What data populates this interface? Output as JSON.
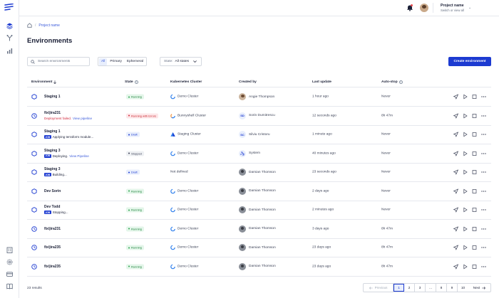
{
  "header": {
    "project_name": "Project name",
    "switch_link": "Switch or view all"
  },
  "breadcrumb": {
    "project": "Project name",
    "separator": "/"
  },
  "page_title": "Environments",
  "toolbar": {
    "search_placeholder": "Search environments",
    "filters": [
      "All",
      "Primary",
      "Ephemeral"
    ],
    "state_label": "State:",
    "state_value": "All states",
    "create_label": "Create environment"
  },
  "table": {
    "headers": {
      "environment": "Environment",
      "state": "State",
      "cluster": "Kubernetes Cluster",
      "created_by": "Created by",
      "last_update": "Last update",
      "auto_stop": "Auto-stop"
    },
    "rows": [
      {
        "name": "Staging 1",
        "tag": "",
        "sub": "",
        "sub_error": "",
        "sub_link": "",
        "icon": "hexagon-icon",
        "state": "Running",
        "state_kind": "running",
        "cluster": "Demo Cluster",
        "cluster_icon": "cluster-ring-icon",
        "creator": "Angie Thompson",
        "creator_avatar": "photo",
        "creator_initials": "",
        "updated": "1 hour ago",
        "autostop": "Never"
      },
      {
        "name": "fix/jira231",
        "tag": "",
        "sub": "",
        "sub_error": "Deployment failed.",
        "sub_link": "View pipeline",
        "icon": "clock-icon",
        "state": "Running with Errors",
        "state_kind": "errors",
        "cluster": "Bunnyshell Cluster",
        "cluster_icon": "cluster-ring-color-icon",
        "creator": "Sorin Dumitrescu",
        "creator_avatar": "initials",
        "creator_initials": "SD",
        "updated": "12 seconds ago",
        "autostop": "8h 47m"
      },
      {
        "name": "Staging 1",
        "tag": "JOB",
        "sub": "Applying terraform module...",
        "sub_error": "",
        "sub_link": "",
        "icon": "hexagon-icon",
        "state": "Draft",
        "state_kind": "draft",
        "cluster": "Staging Cluster",
        "cluster_icon": "cluster-triangle-icon",
        "creator": "Silviu Cristoru",
        "creator_avatar": "initials",
        "creator_initials": "SC",
        "updated": "1 minute ago",
        "autostop": "Never"
      },
      {
        "name": "Staging 3",
        "tag": "JOB",
        "sub": "Deploying.",
        "sub_error": "",
        "sub_link": "View Pipeline",
        "icon": "hexagon-icon",
        "state": "Stopped",
        "state_kind": "stopped",
        "cluster": "Demo Cluster",
        "cluster_icon": "cluster-ring-icon",
        "creator": "System",
        "creator_avatar": "system",
        "creator_initials": "",
        "updated": "40 minutes ago",
        "autostop": "Never"
      },
      {
        "name": "Staging 3",
        "tag": "JOB",
        "sub": "Building...",
        "sub_error": "",
        "sub_link": "",
        "icon": "hexagon-icon",
        "state": "Draft",
        "state_kind": "draft",
        "cluster": "Not defined",
        "cluster_icon": "",
        "creator": "Damian Thomson",
        "creator_avatar": "dark",
        "creator_initials": "",
        "updated": "23 seconds ago",
        "autostop": "Never"
      },
      {
        "name": "Dev Sorin",
        "tag": "",
        "sub": "",
        "sub_error": "",
        "sub_link": "",
        "icon": "hexagon-icon",
        "state": "Running",
        "state_kind": "running",
        "cluster": "Demo Cluster",
        "cluster_icon": "cluster-ring-icon",
        "creator": "Damian Thomson",
        "creator_avatar": "dark",
        "creator_initials": "",
        "updated": "2 days ago",
        "autostop": "Never"
      },
      {
        "name": "Dev Todd",
        "tag": "JOB",
        "sub": "Stopping...",
        "sub_error": "",
        "sub_link": "",
        "icon": "hexagon-icon",
        "state": "Running",
        "state_kind": "running",
        "cluster": "Demo Cluster",
        "cluster_icon": "cluster-ring-icon",
        "creator": "Damian Thomson",
        "creator_avatar": "dark",
        "creator_initials": "",
        "updated": "2 minutes ago",
        "autostop": "Never"
      },
      {
        "name": "fix/jira231",
        "tag": "",
        "sub": "",
        "sub_error": "",
        "sub_link": "",
        "icon": "clock-icon",
        "state": "Running",
        "state_kind": "running",
        "cluster": "Demo Cluster",
        "cluster_icon": "cluster-ring-icon",
        "creator": "Damian Thomson",
        "creator_avatar": "dark",
        "creator_initials": "",
        "updated": "3 days ago",
        "autostop": "8h 47m"
      },
      {
        "name": "fix/jira235",
        "tag": "",
        "sub": "",
        "sub_error": "",
        "sub_link": "",
        "icon": "clock-icon",
        "state": "Running",
        "state_kind": "running",
        "cluster": "Demo Cluster",
        "cluster_icon": "cluster-ring-icon",
        "creator": "Damian Thomson",
        "creator_avatar": "dark",
        "creator_initials": "",
        "updated": "23 days ago",
        "autostop": "8h 47m"
      },
      {
        "name": "fix/jira235",
        "tag": "",
        "sub": "",
        "sub_error": "",
        "sub_link": "",
        "icon": "clock-icon",
        "state": "Running",
        "state_kind": "running",
        "cluster": "Demo Cluster",
        "cluster_icon": "cluster-ring-icon",
        "creator": "Damian Thomson",
        "creator_avatar": "dark",
        "creator_initials": "",
        "updated": "23 days ago",
        "autostop": "8h 47m"
      }
    ]
  },
  "footer": {
    "results": "23 results",
    "previous": "Previous",
    "pages": [
      "1",
      "2",
      "3",
      "...",
      "8",
      "9",
      "10"
    ],
    "current_page": "1",
    "next": "Next"
  },
  "colors": {
    "primary": "#1d3bd1",
    "link": "#3b5bdb",
    "error": "#d1293d",
    "running": "#2da44e"
  }
}
